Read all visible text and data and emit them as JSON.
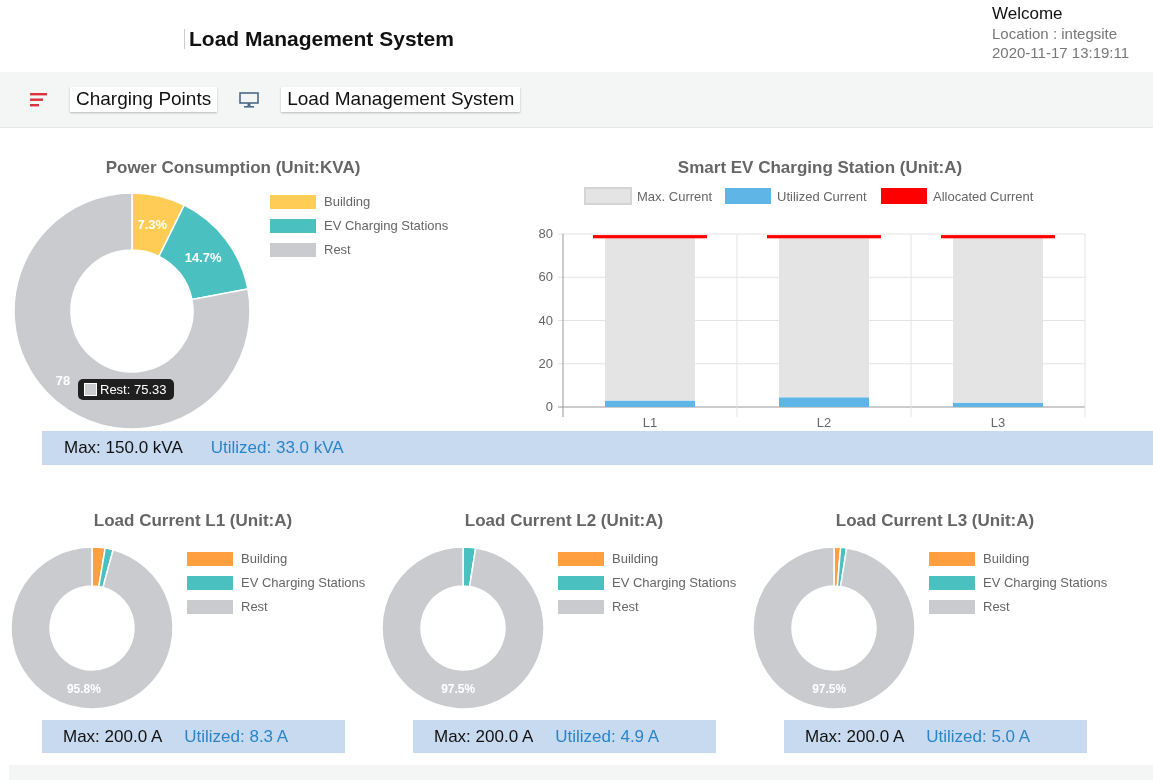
{
  "header": {
    "title": "Load Management System",
    "welcome": "Welcome",
    "location": "Location : integsite",
    "datetime": "2020-11-17 13:19:11"
  },
  "nav": {
    "items": [
      {
        "label": "Charging Points",
        "kind": "menu"
      },
      {
        "label": "Load Management System",
        "kind": "monitor"
      }
    ]
  },
  "power_consumption": {
    "chart_data": {
      "type": "donut",
      "title": "Power Consumption (Unit:KVA)",
      "categories": [
        "Building",
        "EV Charging Stations",
        "Rest"
      ],
      "colors": [
        "#ffcd56",
        "#4bc0c0",
        "#c9cbcf"
      ],
      "series": [
        {
          "values": [
            7.3,
            14.7,
            78.0
          ]
        }
      ],
      "legend": "right",
      "value_labels": [
        "7.3%",
        "14.7%",
        "78"
      ]
    },
    "tooltip": {
      "label": "Rest: 75.33",
      "color": "#c9cbcf"
    },
    "summary": {
      "max": "Max: 150.0 kVA",
      "utilized": "Utilized: 33.0 kVA"
    }
  },
  "ev_station": {
    "chart_data": {
      "type": "bar",
      "title": "Smart EV Charging Station (Unit:A)",
      "categories": [
        "L1",
        "L2",
        "L3"
      ],
      "ylim": [
        0,
        80
      ],
      "yticks": [
        0,
        20,
        40,
        60,
        80
      ],
      "stacked": true,
      "grid": true,
      "legend": "top",
      "series": [
        {
          "name": "Utilized Current",
          "color": "#5eb5e6",
          "values": [
            3,
            4.5,
            2
          ]
        },
        {
          "name": "Max. Current",
          "color": "#e4e4e4",
          "values": [
            75,
            73.5,
            76
          ]
        },
        {
          "name": "Allocated Current",
          "color": "#ff0000",
          "values": [
            1.5,
            1.5,
            1.5
          ]
        }
      ]
    }
  },
  "load_currents": [
    {
      "chart_data": {
        "type": "donut",
        "title": "Load Current L1 (Unit:A)",
        "categories": [
          "Building",
          "EV Charging Stations",
          "Rest"
        ],
        "colors": [
          "#ff9f40",
          "#4bc0c0",
          "#c9cbcf"
        ],
        "series": [
          {
            "values": [
              2.6,
              1.6,
              95.8
            ]
          }
        ],
        "legend": "right",
        "value_labels": [
          null,
          null,
          "95.8%"
        ]
      },
      "summary": {
        "max": "Max: 200.0 A",
        "utilized": "Utilized: 8.3 A"
      }
    },
    {
      "chart_data": {
        "type": "donut",
        "title": "Load Current L2 (Unit:A)",
        "categories": [
          "Building",
          "EV Charging Stations",
          "Rest"
        ],
        "colors": [
          "#ff9f40",
          "#4bc0c0",
          "#c9cbcf"
        ],
        "series": [
          {
            "values": [
              0,
              2.5,
              97.5
            ]
          }
        ],
        "legend": "right",
        "value_labels": [
          null,
          null,
          "97.5%"
        ]
      },
      "summary": {
        "max": "Max: 200.0 A",
        "utilized": "Utilized: 4.9 A"
      }
    },
    {
      "chart_data": {
        "type": "donut",
        "title": "Load Current L3 (Unit:A)",
        "categories": [
          "Building",
          "EV Charging Stations",
          "Rest"
        ],
        "colors": [
          "#ff9f40",
          "#4bc0c0",
          "#c9cbcf"
        ],
        "series": [
          {
            "values": [
              1.3,
              1.2,
              97.5
            ]
          }
        ],
        "legend": "right",
        "value_labels": [
          null,
          null,
          "97.5%"
        ]
      },
      "summary": {
        "max": "Max: 200.0 A",
        "utilized": "Utilized: 5.0 A"
      }
    }
  ]
}
